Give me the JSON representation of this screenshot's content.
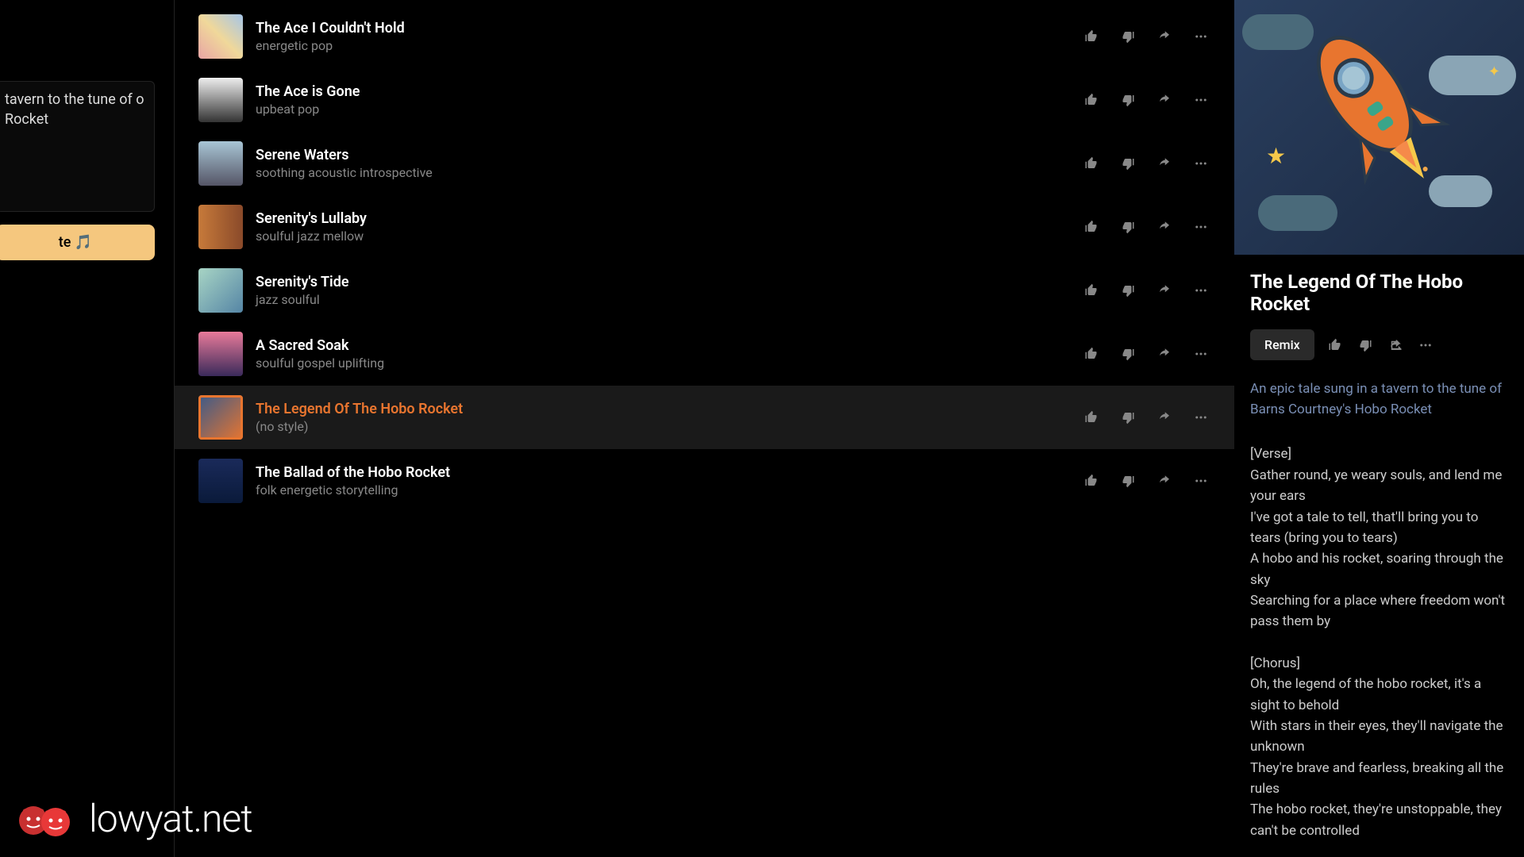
{
  "prompt": {
    "text": "tavern to the tune of o Rocket",
    "create_label": "te 🎵"
  },
  "tracks": [
    {
      "title": "The Ace I Couldn't Hold",
      "style": "energetic pop",
      "selected": false,
      "thumb": "t0"
    },
    {
      "title": "The Ace is Gone",
      "style": "upbeat pop",
      "selected": false,
      "thumb": "t1"
    },
    {
      "title": "Serene Waters",
      "style": "soothing acoustic introspective",
      "selected": false,
      "thumb": "t2"
    },
    {
      "title": "Serenity's Lullaby",
      "style": "soulful jazz mellow",
      "selected": false,
      "thumb": "t3"
    },
    {
      "title": "Serenity's Tide",
      "style": "jazz soulful",
      "selected": false,
      "thumb": "t4"
    },
    {
      "title": "A Sacred Soak",
      "style": "soulful gospel uplifting",
      "selected": false,
      "thumb": "t5"
    },
    {
      "title": "The Legend Of The Hobo Rocket",
      "style": "(no style)",
      "selected": true,
      "thumb": "t6"
    },
    {
      "title": "The Ballad of the Hobo Rocket",
      "style": "folk energetic storytelling",
      "selected": false,
      "thumb": "t7"
    }
  ],
  "detail": {
    "title": "The Legend Of The Hobo Rocket",
    "remix_label": "Remix",
    "description": "An epic tale sung in a tavern to the tune of Barns Courtney's Hobo Rocket",
    "lyrics": "[Verse]\nGather round, ye weary souls, and lend me your ears\nI've got a tale to tell, that'll bring you to tears (bring you to tears)\nA hobo and his rocket, soaring through the sky\nSearching for a place where freedom won't pass them by\n\n[Chorus]\nOh, the legend of the hobo rocket, it's a sight to behold\nWith stars in their eyes, they'll navigate the unknown\nThey're brave and fearless, breaking all the rules\nThe hobo rocket, they're unstoppable, they can't be controlled"
  },
  "watermark": "lowyat.net"
}
